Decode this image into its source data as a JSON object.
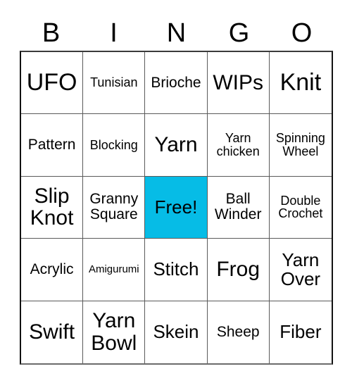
{
  "card": {
    "title_letters": [
      "B",
      "I",
      "N",
      "G",
      "O"
    ],
    "free_cell_color": "#06bce6",
    "grid_line_color": "#5a5a5a",
    "text_color": "#000000",
    "background_color": "#ffffff"
  },
  "grid": {
    "rows": 5,
    "columns": 5,
    "cells": [
      {
        "text": "UFO",
        "size": "fs-xl",
        "free": false
      },
      {
        "text": "Tunisian",
        "size": "fs-xs",
        "free": false
      },
      {
        "text": "Brioche",
        "size": "fs-sm",
        "free": false
      },
      {
        "text": "WIPs",
        "size": "fs-lg",
        "free": false
      },
      {
        "text": "Knit",
        "size": "fs-xl",
        "free": false
      },
      {
        "text": "Pattern",
        "size": "fs-sm",
        "free": false
      },
      {
        "text": "Blocking",
        "size": "fs-xs",
        "free": false
      },
      {
        "text": "Yarn",
        "size": "fs-lg",
        "free": false
      },
      {
        "text": "Yarn\nchicken",
        "size": "fs-xs",
        "free": false
      },
      {
        "text": "Spinning\nWheel",
        "size": "fs-xs",
        "free": false
      },
      {
        "text": "Slip\nKnot",
        "size": "fs-lg",
        "free": false
      },
      {
        "text": "Granny\nSquare",
        "size": "fs-sm",
        "free": false
      },
      {
        "text": "Free!",
        "size": "fs-md",
        "free": true
      },
      {
        "text": "Ball\nWinder",
        "size": "fs-sm",
        "free": false
      },
      {
        "text": "Double\nCrochet",
        "size": "fs-xs",
        "free": false
      },
      {
        "text": "Acrylic",
        "size": "fs-sm",
        "free": false
      },
      {
        "text": "Amigurumi",
        "size": "fs-xxs",
        "free": false
      },
      {
        "text": "Stitch",
        "size": "fs-md",
        "free": false
      },
      {
        "text": "Frog",
        "size": "fs-lg",
        "free": false
      },
      {
        "text": "Yarn\nOver",
        "size": "fs-md",
        "free": false
      },
      {
        "text": "Swift",
        "size": "fs-lg",
        "free": false
      },
      {
        "text": "Yarn\nBowl",
        "size": "fs-lg",
        "free": false
      },
      {
        "text": "Skein",
        "size": "fs-md",
        "free": false
      },
      {
        "text": "Sheep",
        "size": "fs-sm",
        "free": false
      },
      {
        "text": "Fiber",
        "size": "fs-md",
        "free": false
      }
    ]
  }
}
